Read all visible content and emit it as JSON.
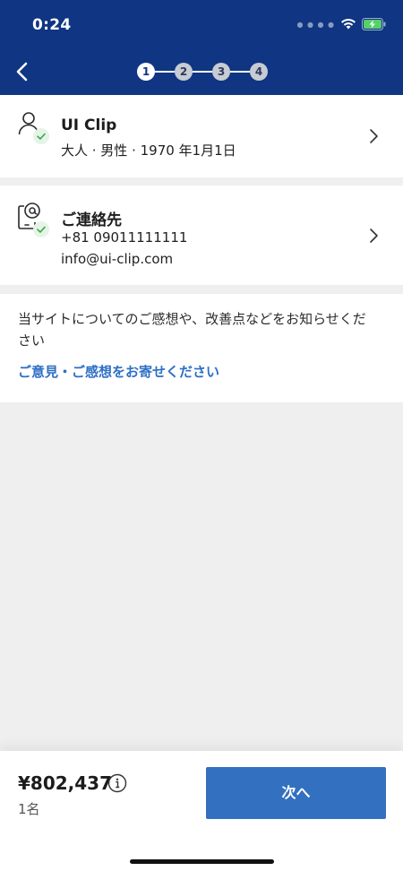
{
  "status": {
    "time": "0:24",
    "icons": [
      "signal-dots",
      "wifi-icon",
      "battery-charging-icon"
    ]
  },
  "nav": {
    "back_icon": "chevron-left-icon",
    "steps": [
      "1",
      "2",
      "3",
      "4"
    ],
    "active_step": 1
  },
  "traveler": {
    "icon": "person-icon",
    "status_icon": "check-icon",
    "name": "UI Clip",
    "details": "大人 · 男性 · 1970 年1月1日"
  },
  "contact": {
    "icon": "phone-at-icon",
    "status_icon": "check-icon",
    "title": "ご連絡先",
    "phone": "+81 09011111111",
    "email": "info@ui-clip.com"
  },
  "feedback": {
    "text": "当サイトについてのご感想や、改善点などをお知らせください",
    "link": "ご意見・ご感想をお寄せください"
  },
  "footer": {
    "price": "¥802,437",
    "passengers": "1名",
    "next_label": "次へ",
    "info_icon": "info-icon"
  },
  "colors": {
    "header": "#0f3583",
    "accent": "#3370c0",
    "link": "#2e6fc4",
    "check": "#3aa84a",
    "background": "#efeff0"
  }
}
